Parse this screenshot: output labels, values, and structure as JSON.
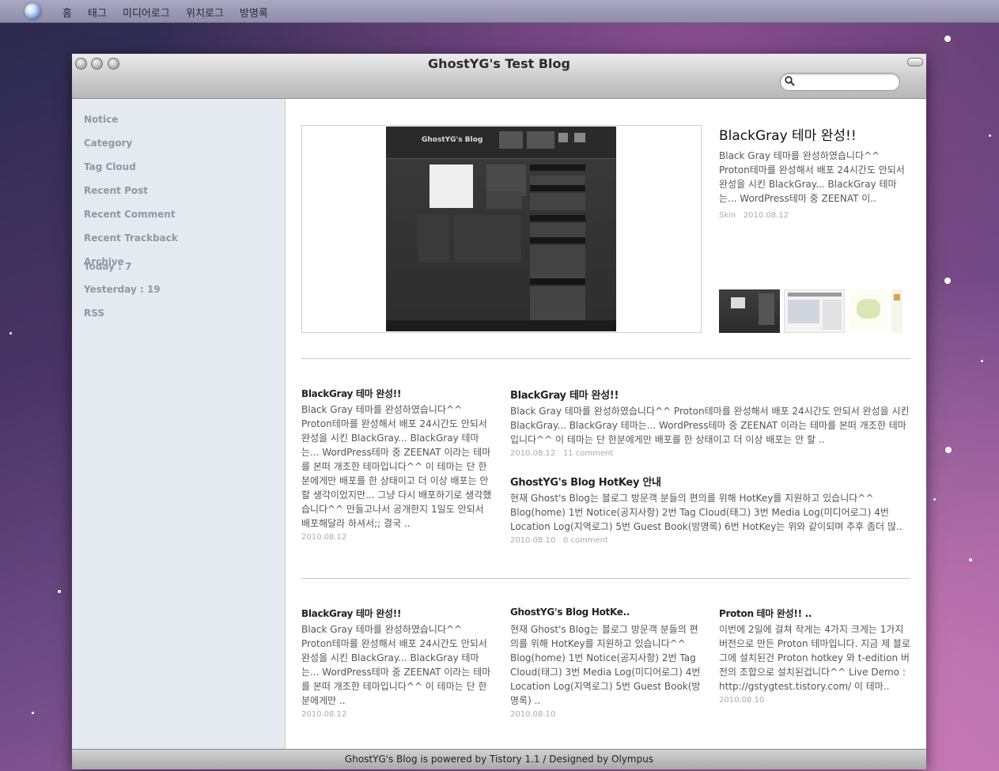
{
  "menubar": {
    "items": [
      "홈",
      "태그",
      "미디어로그",
      "위치로그",
      "방명록"
    ]
  },
  "window": {
    "title": "GhostYG's Test Blog",
    "search_placeholder": ""
  },
  "sidebar": {
    "items": [
      "Notice",
      "Category",
      "Tag Cloud",
      "Recent Post",
      "Recent Comment",
      "Recent Trackback",
      "Archive"
    ],
    "today": "Today : 7",
    "yesterday": "Yesterday : 19",
    "rss": "RSS"
  },
  "featured": {
    "title": "BlackGray 테마 완성!!",
    "desc": "Black Gray 테마를 완성하였습니다^^ Proton테마를 완성해서 배포 24시간도 안되서 완성을 시킨 BlackGray... BlackGray 테마는... WordPress테마 중 ZEENAT 이..",
    "category": "Skin",
    "date": "2010.08.12",
    "shot": {
      "blog_name": "GhostYG's Blog"
    }
  },
  "row1": {
    "left": {
      "title": "BlackGray 테마 완성!!",
      "desc": "Black Gray 테마를 완성하였습니다^^ Proton테마를 완성해서 배포 24시간도 안되서 완성을 시킨 BlackGray... BlackGray 테마는... WordPress테마 중 ZEENAT 이라는 테마를 본떠 개조한 테마입니다^^ 이 테마는 단 한분에게만 배포를 한 상태이고 더 이상 배포는 안 할 생각이었지만... 그냥 다시 배포하기로 생각했습니다^^ 만들고나서 공개한지 1일도 안되서 배포해달라 하셔서;; 결국 ..",
      "date": "2010.08.12"
    },
    "right": [
      {
        "title": "BlackGray 테마 완성!!",
        "desc": "Black Gray 테마를 완성하였습니다^^ Proton테마를 완성해서 배포 24시간도 안되서 완성을 시킨 BlackGray... BlackGray 테마는... WordPress테마 중 ZEENAT 이라는 테마를 본떠 개조한 테마입니다^^ 이 테마는 단 한분에게만 배포를 한 상태이고 더 이상 배포는 안 할 ..",
        "date": "2010.08.12",
        "comments": "11 comment"
      },
      {
        "title": "GhostYG's Blog HotKey 안내",
        "desc": "현재 Ghost's Blog는 블로그 방문객 분들의 편의를 위해 HotKey를 지원하고 있습니다^^ Blog(home) 1번 Notice(공지사항) 2번 Tag Cloud(태그) 3번 Media Log(미디어로그) 4번 Location Log(지역로그) 5번 Guest Book(방명록) 6번 HotKey는 위와 같이되며 추후 좀더 많..",
        "date": "2010.08.10",
        "comments": "0 comment"
      }
    ]
  },
  "row2": [
    {
      "title": "BlackGray 테마 완성!!",
      "desc": "Black Gray 테마를 완성하였습니다^^ Proton테마를 완성해서 배포 24시간도 안되서 완성을 시킨 BlackGray... BlackGray 테마는... WordPress테마 중 ZEENAT 이라는 테마를 본떠 개조한 테마입니다^^ 이 테마는 단 한분에게만 ..",
      "date": "2010.08.12"
    },
    {
      "title": "GhostYG's Blog HotKe..",
      "desc": "현재 Ghost's Blog는 블로그 방문객 분들의 편의를 위해 HotKey를 지원하고 있습니다^^ Blog(home) 1번 Notice(공지사항) 2번 Tag Cloud(태그) 3번 Media Log(미디어로그) 4번 Location Log(지역로그) 5번 Guest Book(방명록) ..",
      "date": "2010.08.10"
    },
    {
      "title": "Proton 테마 완성!! ..",
      "desc": "이번에 2일에 걸쳐 작게는 4가지 크게는 1가지 버전으로 만든 Proton 테마입니다. 지금 제 블로그에 설치된건 Proton hotkey 와 t-edition 버전의 조합으로 설치된겁니다^^ Live Demo : http://gstygtest.tistory.com/ 이 테마..",
      "date": "2010.08.10"
    }
  ],
  "footer": {
    "text": "GhostYG's Blog is powered by Tistory 1.1 / Designed by Olympus"
  }
}
